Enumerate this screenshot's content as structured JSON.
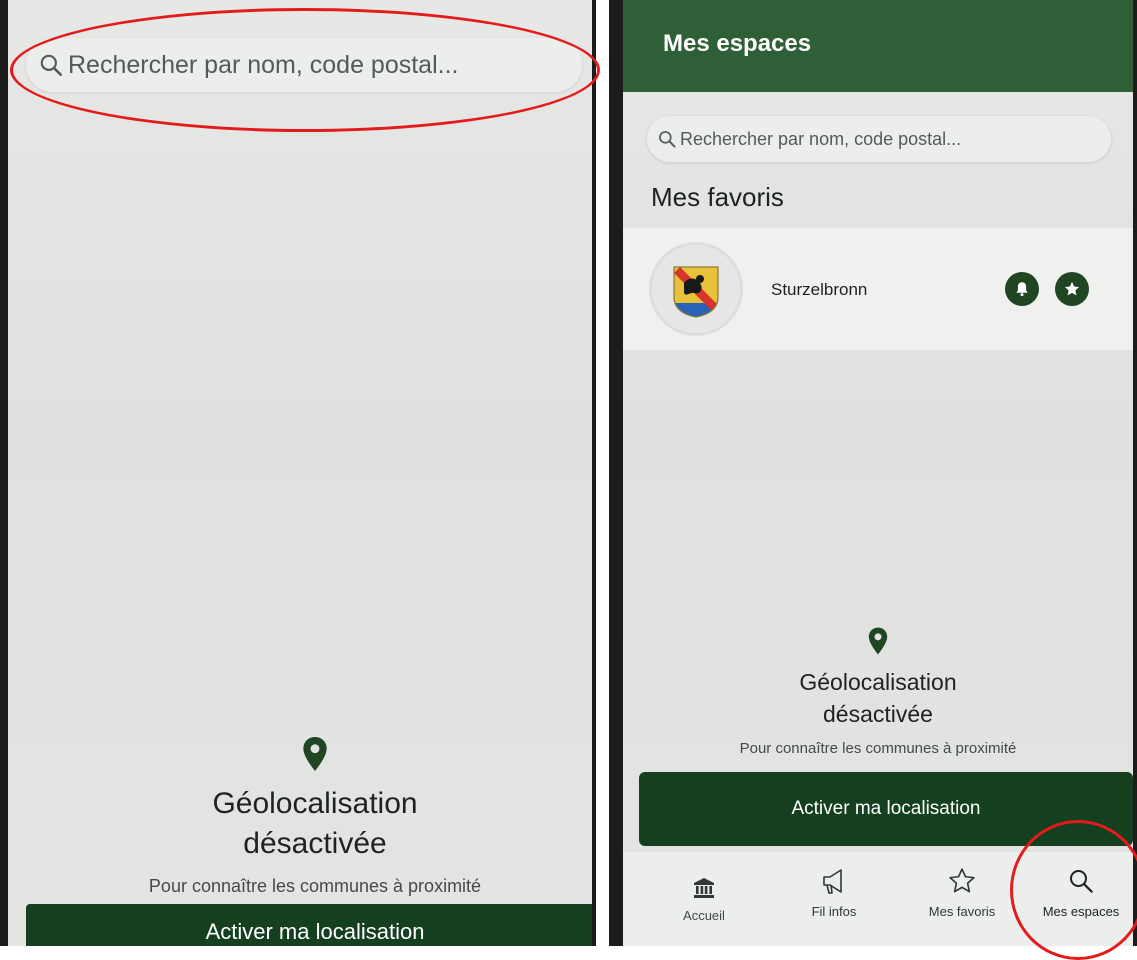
{
  "left_panel": {
    "search_placeholder": "Rechercher par nom, code postal...",
    "geo_title": "Géolocalisation désactivée",
    "geo_subtitle": "Pour connaître les communes à proximité",
    "activate_label": "Activer ma localisation"
  },
  "right_panel": {
    "header_title": "Mes espaces",
    "search_placeholder": "Rechercher par nom, code postal...",
    "favorites_heading": "Mes favoris",
    "favorites": [
      {
        "name": "Sturzelbronn"
      }
    ],
    "geo_title": "Géolocalisation désactivée",
    "geo_subtitle": "Pour connaître les communes à proximité",
    "activate_label": "Activer ma localisation",
    "nav": [
      {
        "label": "Accueil",
        "icon": "bank-icon"
      },
      {
        "label": "Fil infos",
        "icon": "megaphone-icon"
      },
      {
        "label": "Mes favoris",
        "icon": "star-outline-icon"
      },
      {
        "label": "Mes espaces",
        "icon": "search-icon"
      }
    ]
  },
  "colors": {
    "brand_green": "#14401f",
    "header_green": "#2f5f36",
    "annotation_red": "#e31b1b"
  }
}
